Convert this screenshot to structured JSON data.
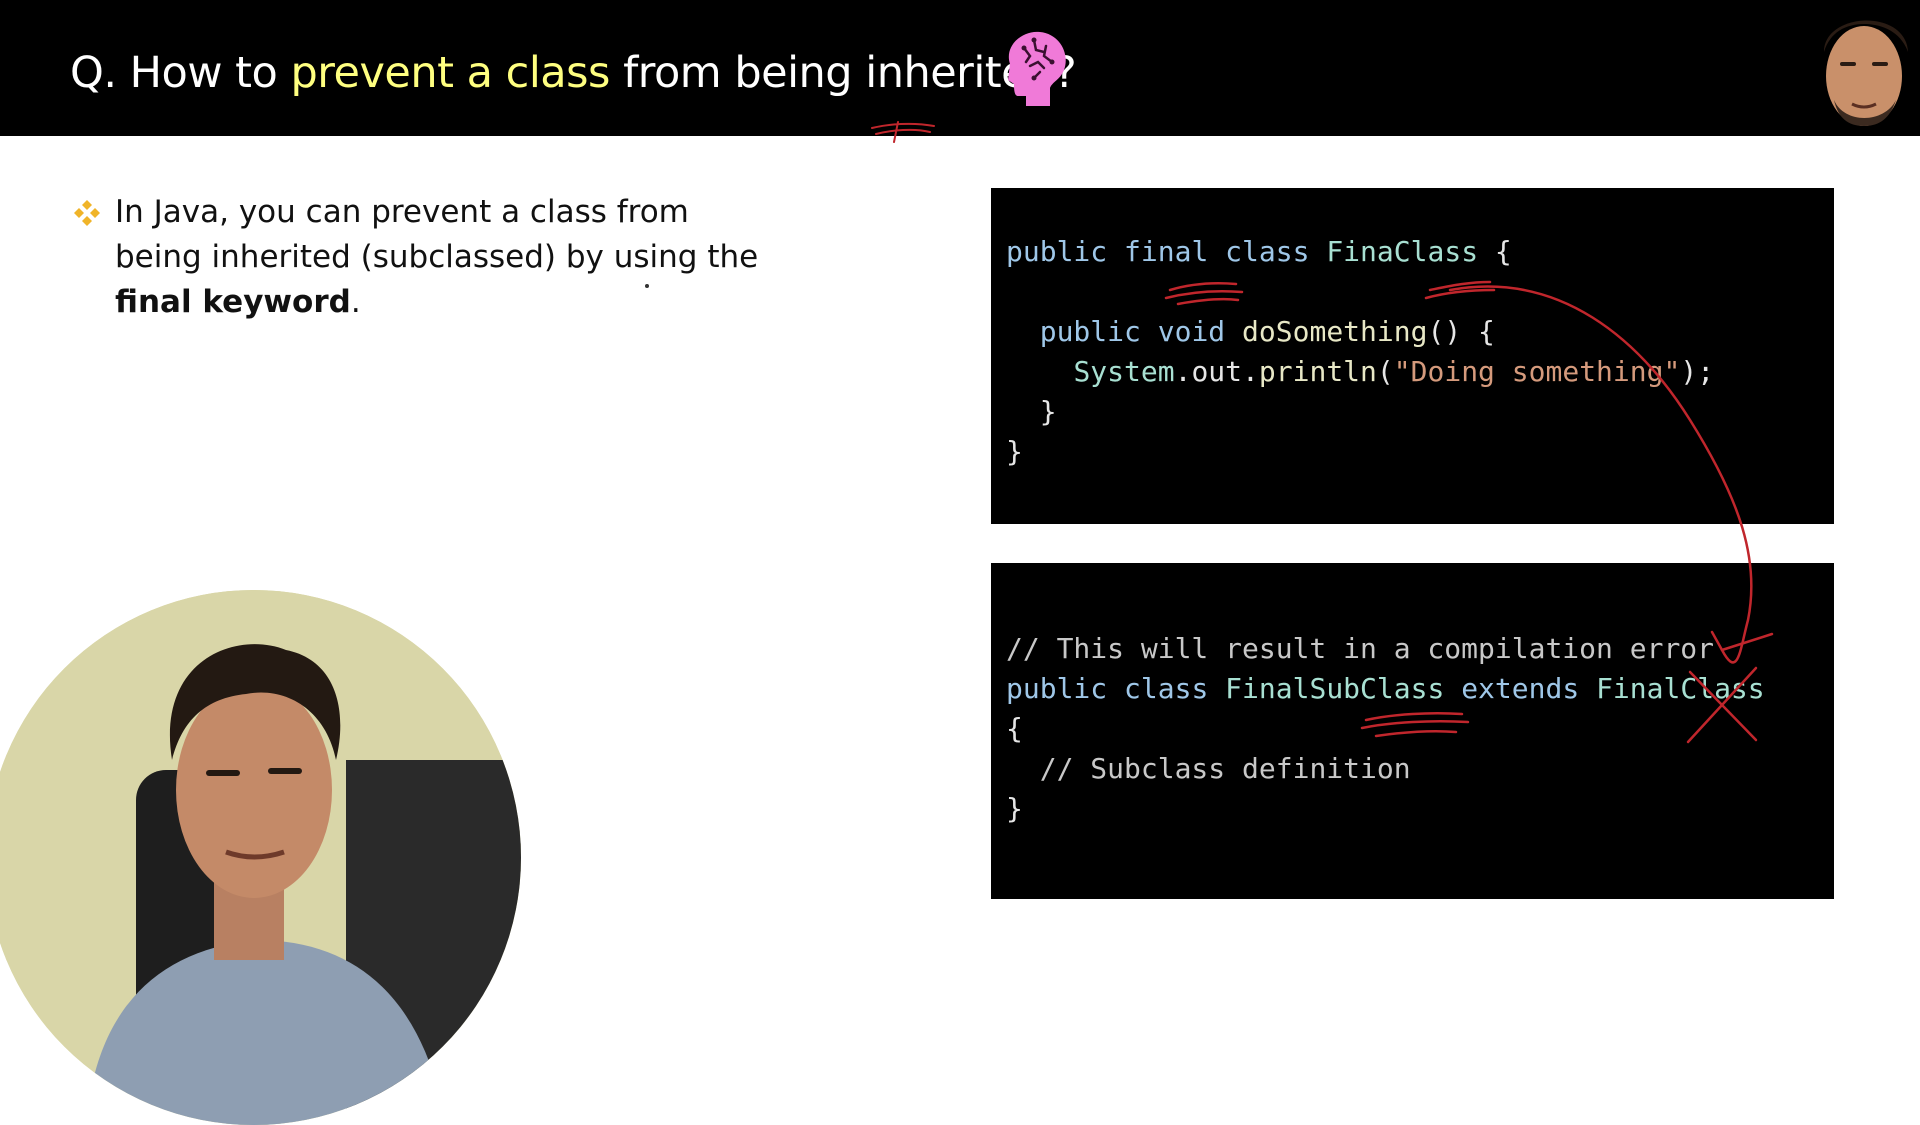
{
  "slide": {
    "title_prefix": "Q. How to ",
    "title_highlight": "prevent a class",
    "title_suffix": " from being inherited?",
    "bullet": {
      "part1": "In Java, you can prevent a class from being inherited (subclassed) by using the ",
      "keyword": "final keyword",
      "end": "."
    }
  },
  "code_block_1": {
    "l1": {
      "a": "public",
      "b": "final",
      "c": "class",
      "d": "FinaClass",
      "e": "{"
    },
    "l2": {
      "a": "public",
      "b": "void",
      "c": "doSomething",
      "d": "() {"
    },
    "l3": {
      "a": "System",
      "b": ".out.",
      "c": "println",
      "d": "(",
      "e": "\"Doing something\"",
      "f": ");"
    },
    "l4": "}",
    "l5": "}"
  },
  "code_block_2": {
    "l1": "// This will result in a compilation error",
    "l2": {
      "a": "public",
      "b": "class",
      "c": "FinalSubClass",
      "d": "extends",
      "e": "FinalClass"
    },
    "l3": "{",
    "l4": "// Subclass definition",
    "l5": "}"
  },
  "colors": {
    "header_bg": "#000000",
    "title_highlight": "#ffff80",
    "code_bg": "#000000",
    "annotation_red": "#c0262c",
    "brain_icon": "#f07ad8"
  },
  "icons": [
    "brain-icon",
    "diamond-bullet-icon",
    "presenter-avatar",
    "presenter-webcam"
  ]
}
